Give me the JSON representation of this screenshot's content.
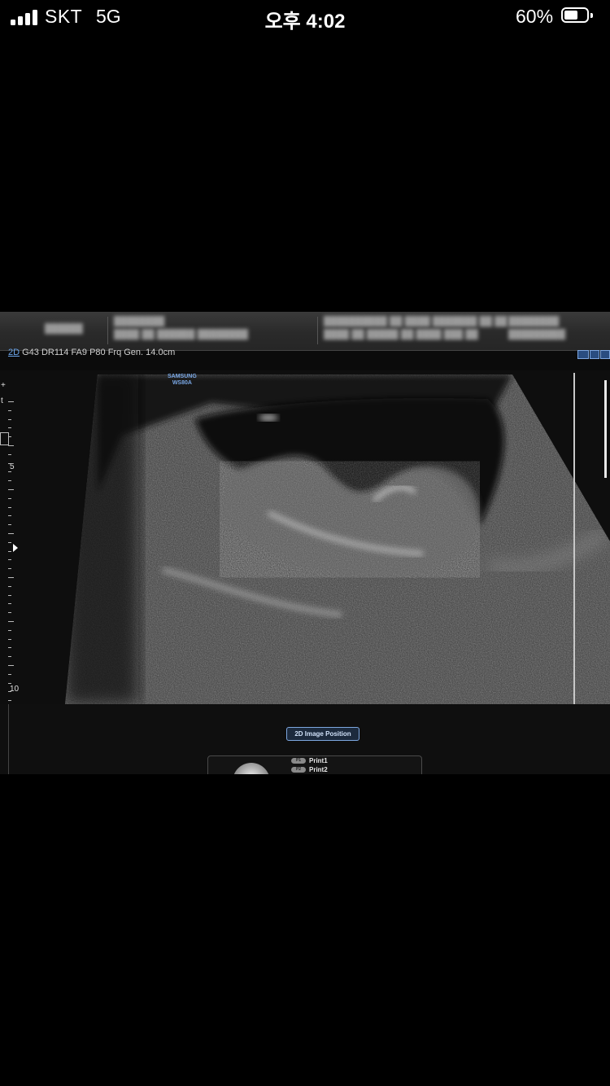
{
  "status_bar": {
    "carrier": "SKT",
    "network": "5G",
    "time": "오후 4:02",
    "battery_percent": "60%",
    "battery_level": 0.6,
    "signal_bars": 4
  },
  "ultrasound": {
    "parameters": {
      "mode": "2D",
      "text": " G43 DR114 FA9 P80 Frq Gen. 14.0cm"
    },
    "brand": "SAMSUNG",
    "model": "WS80A",
    "depth_labels": [
      "5",
      "10"
    ],
    "image_position_button": "2D Image Position",
    "print_options": [
      {
        "badge": "P1",
        "label": "Print1"
      },
      {
        "badge": "P2",
        "label": "Print2"
      }
    ]
  }
}
